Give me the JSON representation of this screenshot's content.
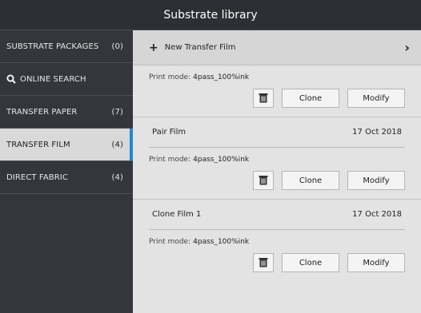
{
  "title": "Substrate library",
  "sidebar": {
    "items": [
      {
        "label": "SUBSTRATE PACKAGES",
        "count": "(0)"
      },
      {
        "label": "ONLINE SEARCH",
        "count": ""
      },
      {
        "label": "TRANSFER PAPER",
        "count": "(7)"
      },
      {
        "label": "TRANSFER FILM",
        "count": "(4)"
      },
      {
        "label": "DIRECT FABRIC",
        "count": "(4)"
      }
    ]
  },
  "main": {
    "new_label": "New Transfer Film",
    "entries": [
      {
        "name": "",
        "date": "",
        "print_mode_label": "Print mode:",
        "print_mode": "4pass_100%ink"
      },
      {
        "name": "Pair Film",
        "date": "17 Oct 2018",
        "print_mode_label": "Print mode:",
        "print_mode": "4pass_100%ink"
      },
      {
        "name": "Clone Film 1",
        "date": "17 Oct 2018",
        "print_mode_label": "Print mode:",
        "print_mode": "4pass_100%ink"
      }
    ],
    "clone_label": "Clone",
    "modify_label": "Modify"
  },
  "colors": {
    "accent": "#1e88d0",
    "sidebar_bg": "#33373c",
    "title_bg": "#2c3035"
  }
}
